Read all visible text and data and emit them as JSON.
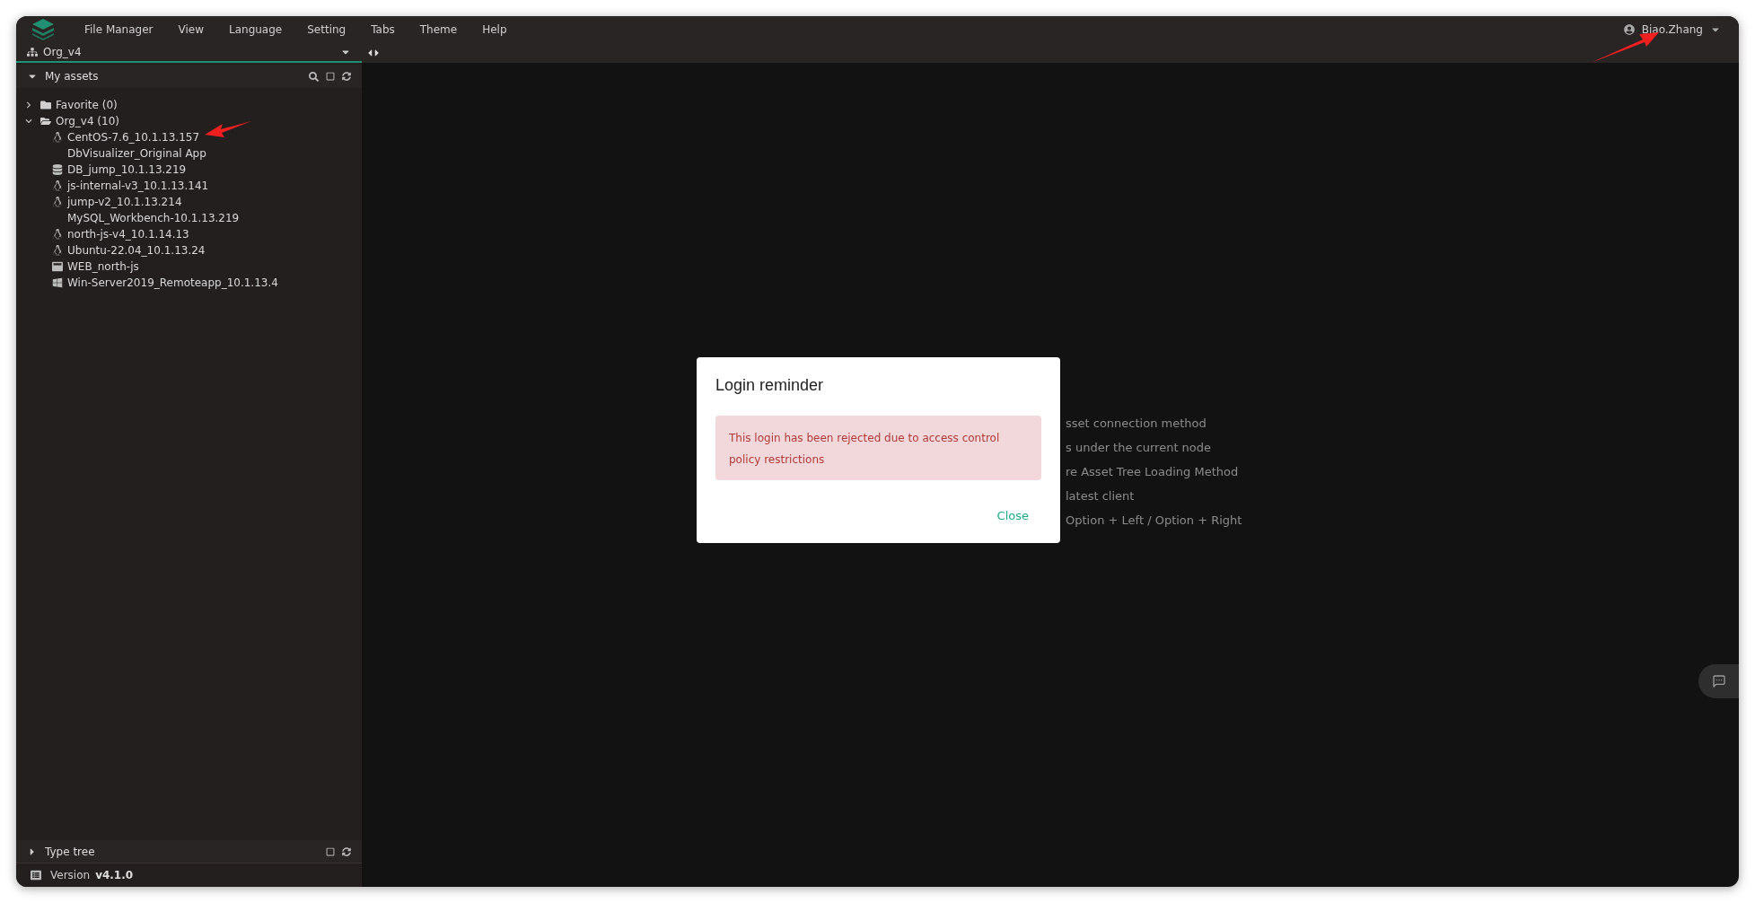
{
  "menu": [
    "File Manager",
    "View",
    "Language",
    "Setting",
    "Tabs",
    "Theme",
    "Help"
  ],
  "user": {
    "name": "Biao.Zhang"
  },
  "org_selector": {
    "value": "Org_v4"
  },
  "my_assets": {
    "title": "My assets",
    "expanded": true,
    "tree": [
      {
        "label": "Favorite (0)",
        "kind": "folder",
        "expanded": false
      },
      {
        "label": "Org_v4 (10)",
        "kind": "folder",
        "expanded": true,
        "children": [
          {
            "label": "CentOS-7.6_10.1.13.157",
            "kind": "linux"
          },
          {
            "label": "DbVisualizer_Original App",
            "kind": "app"
          },
          {
            "label": "DB_jump_10.1.13.219",
            "kind": "database"
          },
          {
            "label": "js-internal-v3_10.1.13.141",
            "kind": "linux"
          },
          {
            "label": "jump-v2_10.1.13.214",
            "kind": "linux"
          },
          {
            "label": "MySQL_Workbench-10.1.13.219",
            "kind": "app"
          },
          {
            "label": "north-js-v4_10.1.14.13",
            "kind": "linux"
          },
          {
            "label": "Ubuntu-22.04_10.1.13.24",
            "kind": "linux"
          },
          {
            "label": "WEB_north-js",
            "kind": "web"
          },
          {
            "label": "Win-Server2019_Remoteapp_10.1.13.4",
            "kind": "windows"
          }
        ]
      }
    ]
  },
  "type_tree": {
    "title": "Type tree",
    "expanded": false
  },
  "version": {
    "label": "Version",
    "value": "v4.1.0"
  },
  "hints": [
    "sset connection method",
    "s under the current node",
    "re Asset Tree Loading Method",
    "latest client",
    "Option + Left / Option + Right"
  ],
  "dialog": {
    "title": "Login reminder",
    "message": "This login has been rejected due to access control policy restrictions",
    "button": "Close"
  }
}
